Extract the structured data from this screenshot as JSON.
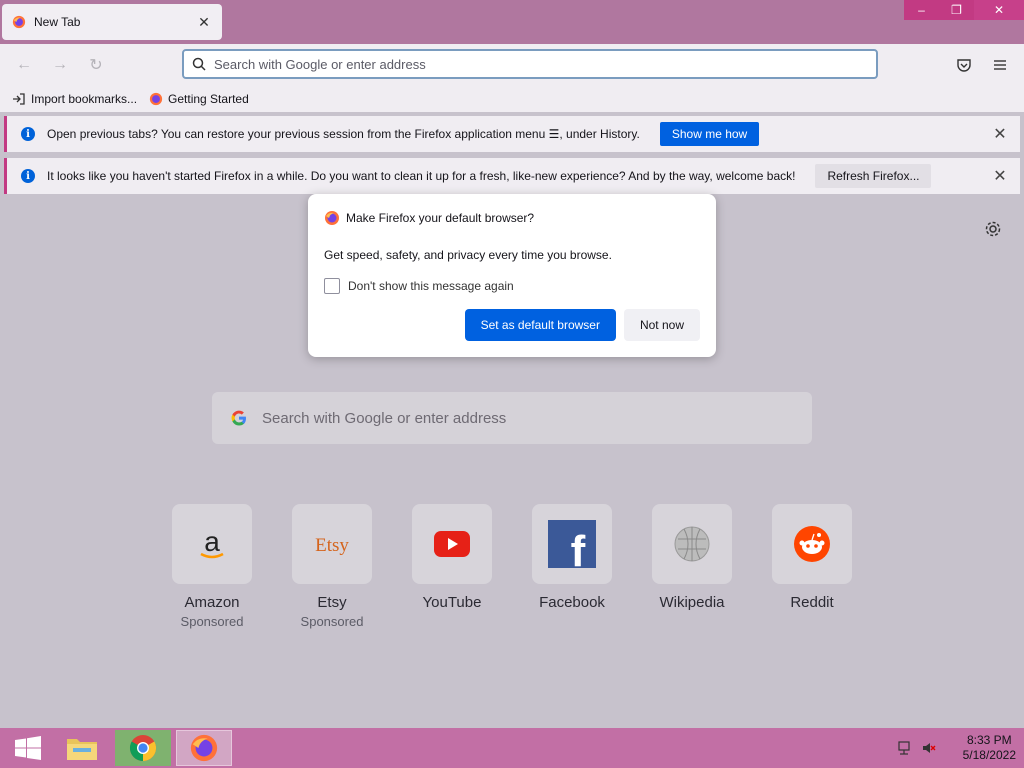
{
  "tab": {
    "title": "New Tab"
  },
  "window": {
    "minimize": "–",
    "restore": "❐",
    "close": "✕"
  },
  "navbar": {
    "url_placeholder": "Search with Google or enter address"
  },
  "bookmarks": [
    {
      "label": "Import bookmarks..."
    },
    {
      "label": "Getting Started"
    }
  ],
  "notifications": [
    {
      "text": "Open previous tabs? You can restore your previous session from the Firefox application menu ☰, under History.",
      "button": "Show me how"
    },
    {
      "text": "It looks like you haven't started Firefox in a while. Do you want to clean it up for a fresh, like-new experience? And by the way, welcome back!",
      "button": "Refresh Firefox..."
    }
  ],
  "search": {
    "placeholder": "Search with Google or enter address"
  },
  "tiles": [
    {
      "name": "Amazon",
      "sub": "Sponsored",
      "glyph": "a"
    },
    {
      "name": "Etsy",
      "sub": "Sponsored",
      "glyph": "Etsy"
    },
    {
      "name": "YouTube",
      "sub": ""
    },
    {
      "name": "Facebook",
      "sub": "",
      "glyph": "f"
    },
    {
      "name": "Wikipedia",
      "sub": ""
    },
    {
      "name": "Reddit",
      "sub": ""
    }
  ],
  "modal": {
    "title": "Make Firefox your default browser?",
    "body": "Get speed, safety, and privacy every time you browse.",
    "checkbox": "Don't show this message again",
    "primary": "Set as default browser",
    "secondary": "Not now"
  },
  "taskbar": {
    "time": "8:33 PM",
    "date": "5/18/2022"
  },
  "colors": {
    "accent": "#0061e0",
    "tabstrip": "#b0779f",
    "taskbar": "#c26fa5"
  }
}
